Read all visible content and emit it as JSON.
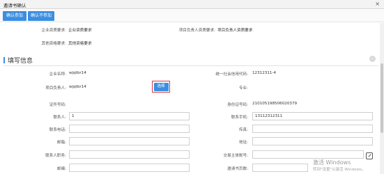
{
  "window": {
    "title": "邀请书确认",
    "close_glyph": "×"
  },
  "toolbar": {
    "accept_label": "确认参加",
    "decline_label": "确认不参加"
  },
  "requirements": {
    "company_requirement_label": "企业资质要求:",
    "company_requirement_value": "企业资质要求",
    "leader_requirement_label": "项目负责人资质要求:",
    "leader_requirement_value": "项目负责人资质要求",
    "other_requirement_label": "其他资格要求:",
    "other_requirement_value": "其他资格要求"
  },
  "section": {
    "title": "填写信息",
    "collapse_glyph": "−"
  },
  "form": {
    "company_name_label": "企业名称:",
    "company_name_value": "wjqtbr14",
    "credit_code_label": "统一社会信用代码:",
    "credit_code_value": "12312311-4",
    "project_leader_label": "项目负责人:",
    "project_leader_value": "wjqtbr14",
    "select_button_label": "选择",
    "title_label": "专业:",
    "cert_no_label": "证件号码:",
    "id_no_label": "身份证号码:",
    "id_no_value": "210105198506020379",
    "contact_label": "联系人:",
    "contact_value": "1",
    "mobile_label": "联系手机:",
    "mobile_value": "13112312311",
    "phone_label": "联系电话:",
    "fax_label": "传真:",
    "email_label": "邮箱:",
    "address_label": "地址:",
    "contact_position_label": "联系人职务:",
    "trade_account_label": "交易主体账号:",
    "postcode_label": "邮编:",
    "invite_count_label": "邀请书页数:"
  },
  "watermark": {
    "line1": "激活 Windows",
    "line2": "转到\"设置\"以激活 Windows。"
  },
  "icons": {
    "edit": "edit-icon"
  }
}
